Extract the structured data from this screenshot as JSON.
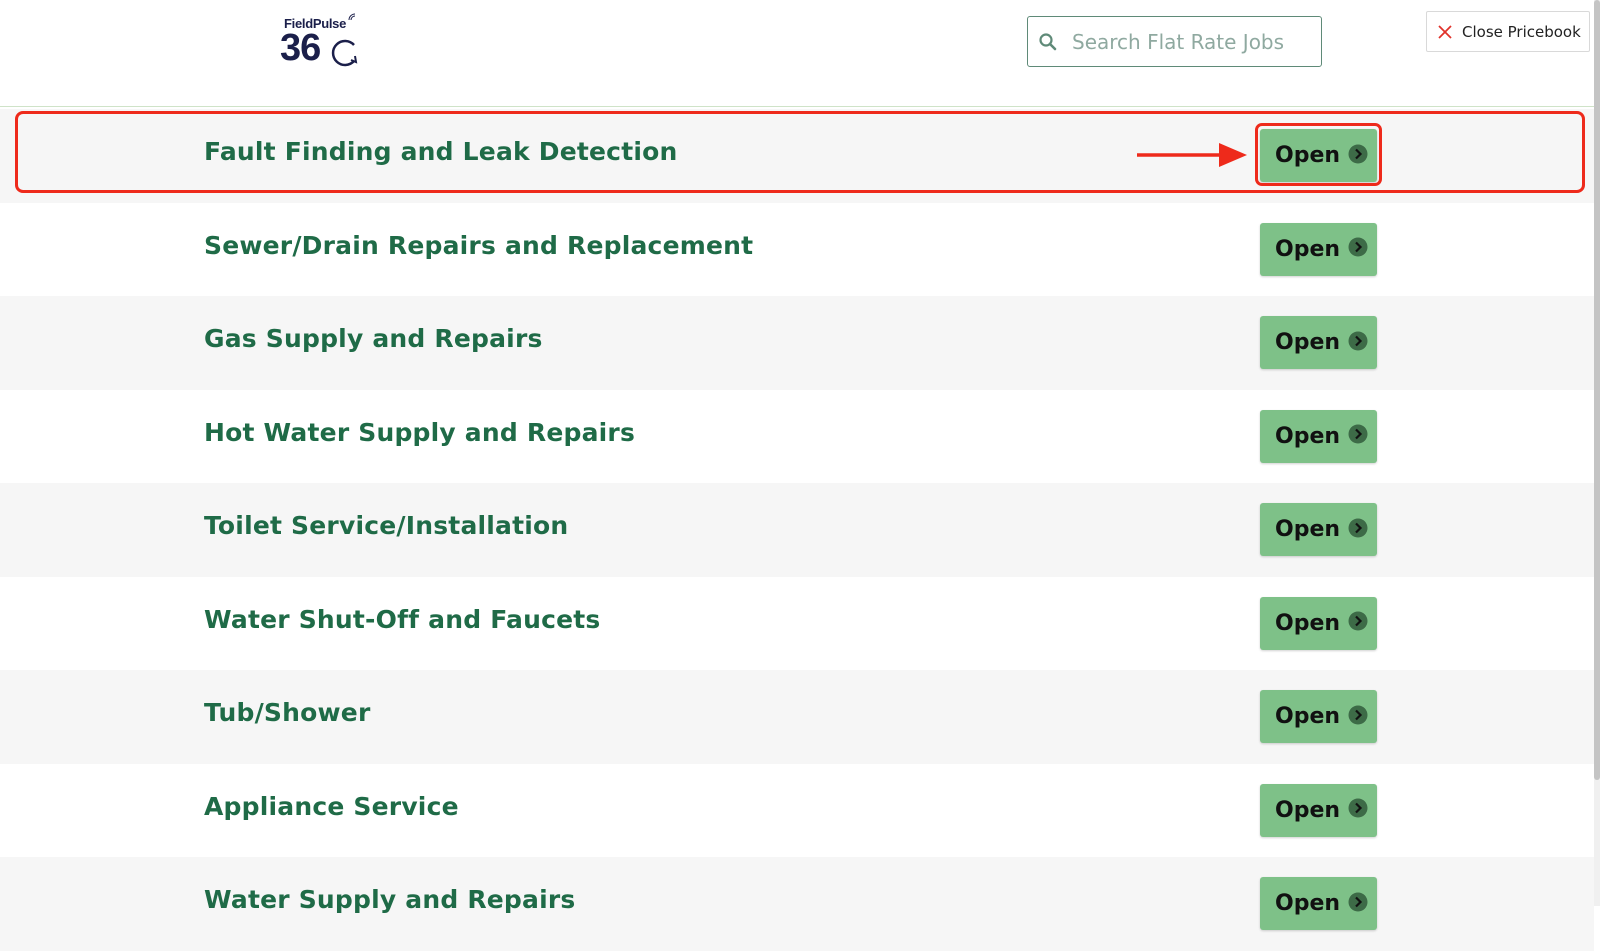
{
  "app": {
    "logo_top": "FieldPulse",
    "logo_main": "36"
  },
  "header": {
    "search_placeholder": "Search Flat Rate Jobs",
    "search_value": "",
    "close_label": "Close Pricebook"
  },
  "categories": [
    {
      "title": "Fault Finding and Leak Detection",
      "button": "Open"
    },
    {
      "title": "Sewer/Drain Repairs and Replacement",
      "button": "Open"
    },
    {
      "title": "Gas Supply and Repairs",
      "button": "Open"
    },
    {
      "title": "Hot Water Supply and Repairs",
      "button": "Open"
    },
    {
      "title": "Toilet Service/Installation",
      "button": "Open"
    },
    {
      "title": "Water Shut-Off and Faucets",
      "button": "Open"
    },
    {
      "title": "Tub/Shower",
      "button": "Open"
    },
    {
      "title": "Appliance Service",
      "button": "Open"
    },
    {
      "title": "Water Supply and Repairs",
      "button": "Open"
    }
  ],
  "icons": {
    "search": "search-icon",
    "close": "close-icon",
    "open_chevron": "chevron-right-icon"
  },
  "colors": {
    "title_green": "#1f6b47",
    "button_green": "#7ec188",
    "annotation_red": "#ee2a1b",
    "logo_navy": "#1b1f4a"
  }
}
